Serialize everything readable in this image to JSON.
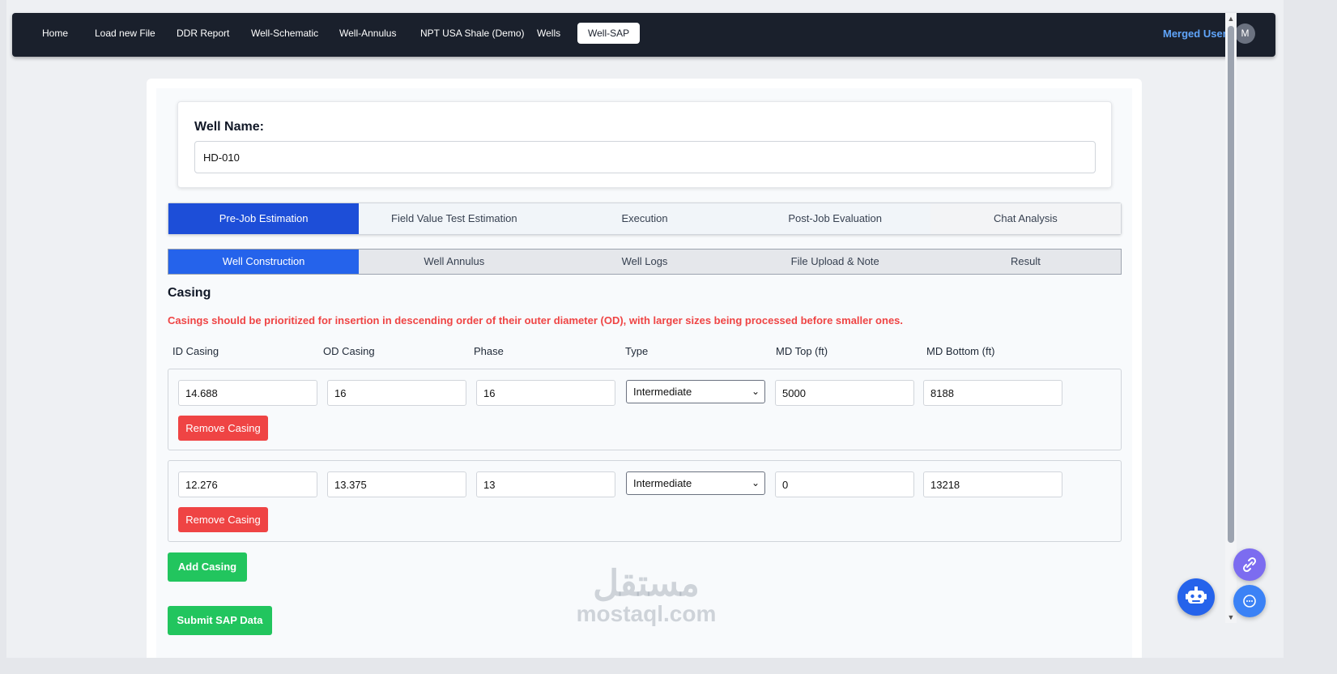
{
  "nav": {
    "items": [
      "Home",
      "Load new File",
      "DDR Report",
      "Well-Schematic",
      "Well-Annulus",
      "NPT USA Shale (Demo)",
      "Wells",
      "Well-SAP"
    ],
    "active": "Well-SAP",
    "user_name": "Merged User",
    "avatar_initial": "M"
  },
  "well": {
    "label": "Well Name:",
    "value": "HD-010"
  },
  "main_tabs": [
    "Pre-Job Estimation",
    "Field Value Test Estimation",
    "Execution",
    "Post-Job Evaluation",
    "Chat Analysis"
  ],
  "sub_tabs": [
    "Well Construction",
    "Well Annulus",
    "Well Logs",
    "File Upload & Note",
    "Result"
  ],
  "casing": {
    "title": "Casing",
    "warning": "Casings should be prioritized for insertion in descending order of their outer diameter (OD), with larger sizes being processed before smaller ones.",
    "columns": [
      "ID Casing",
      "OD Casing",
      "Phase",
      "Type",
      "MD Top (ft)",
      "MD Bottom (ft)"
    ],
    "rows": [
      {
        "id": "14.688",
        "od": "16",
        "phase": "16",
        "type": "Intermediate",
        "md_top": "5000",
        "md_bottom": "8188"
      },
      {
        "id": "12.276",
        "od": "13.375",
        "phase": "13",
        "type": "Intermediate",
        "md_top": "0",
        "md_bottom": "13218"
      }
    ],
    "remove_label": "Remove Casing",
    "add_label": "Add Casing",
    "submit_label": "Submit SAP Data"
  },
  "watermark": {
    "arabic": "مستقل",
    "latin": "mostaql.com"
  },
  "colors": {
    "navbar": "#1a202c",
    "primary": "#1d4ed8",
    "danger": "#ef4444",
    "success": "#22c55e",
    "user_link": "#60a5fa"
  }
}
